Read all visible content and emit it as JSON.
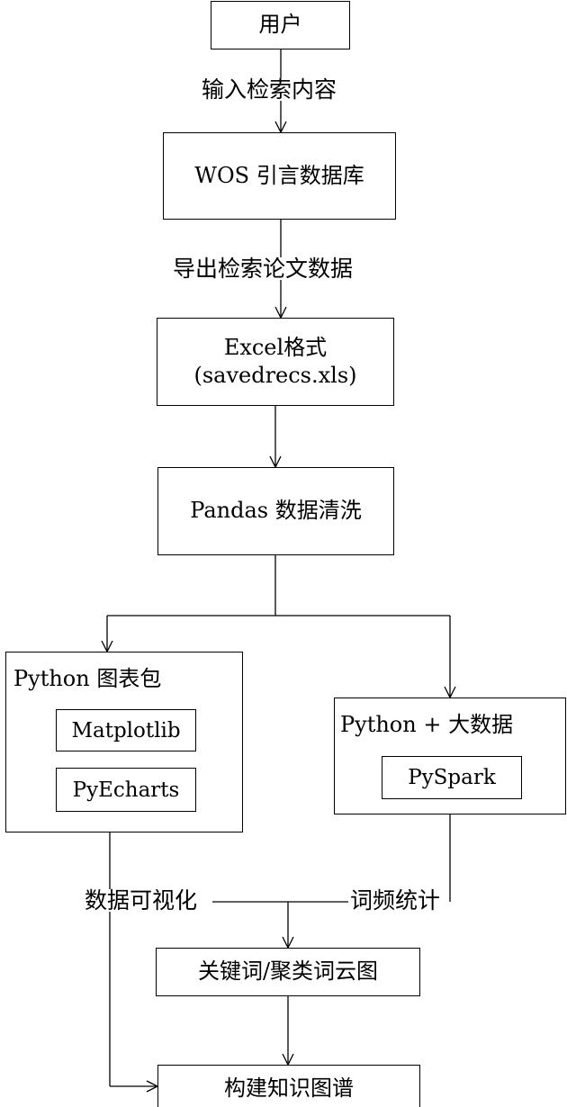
{
  "nodes": {
    "user": "用户",
    "wos": "WOS 引言数据库",
    "excel_line1": "Excel格式",
    "excel_line2": "(savedrecs.xls)",
    "pandas": "Pandas 数据清洗",
    "python_charts": {
      "title": "Python 图表包",
      "items": [
        "Matplotlib",
        "PyEcharts"
      ]
    },
    "python_bigdata": {
      "title": "Python + 大数据",
      "items": [
        "PySpark"
      ]
    },
    "wordcloud": "关键词/聚类词云图",
    "knowledge_graph": "构建知识图谱"
  },
  "edges": {
    "input_search": "输入检索内容",
    "export_papers": "导出检索论文数据",
    "visualization": "数据可视化",
    "word_freq": "词频统计"
  }
}
